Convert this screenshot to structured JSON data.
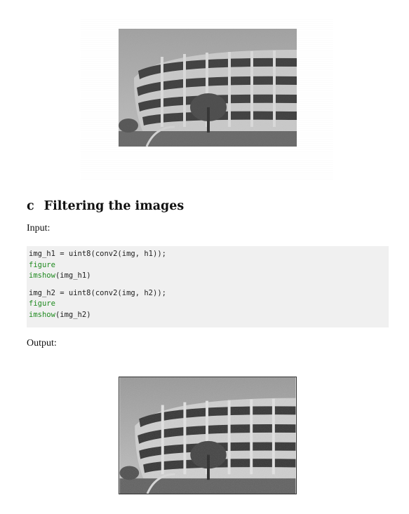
{
  "section": {
    "number": "c",
    "title": "Filtering the images"
  },
  "input_label": "Input:",
  "output_label": "Output:",
  "code": {
    "group1": {
      "line1": "img_h1 = uint8(conv2(img, h1));",
      "line2_fn": "figure",
      "line3_fn": "imshow",
      "line3_args": "(img_h1)"
    },
    "group2": {
      "line1": "img_h2 = uint8(conv2(img, h2));",
      "line2_fn": "figure",
      "line3_fn": "imshow",
      "line3_args": "(img_h2)"
    }
  },
  "colors": {
    "keyword": "#1f8a1f",
    "code_bg": "#f0f0f0"
  }
}
